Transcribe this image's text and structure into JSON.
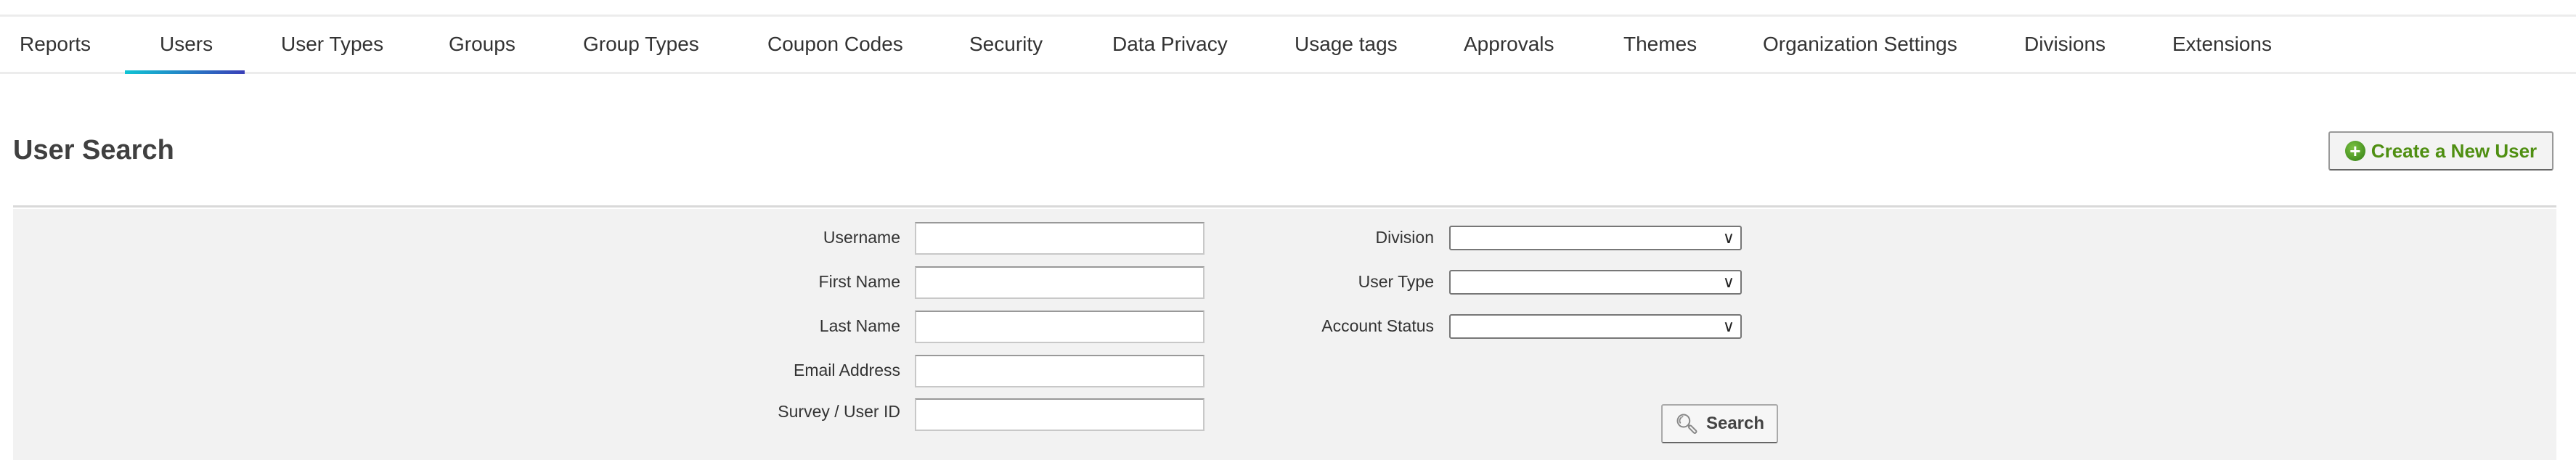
{
  "nav": {
    "tabs": [
      "Reports",
      "Users",
      "User Types",
      "Groups",
      "Group Types",
      "Coupon Codes",
      "Security",
      "Data Privacy",
      "Usage tags",
      "Approvals",
      "Themes",
      "Organization Settings",
      "Divisions",
      "Extensions"
    ],
    "active": "Users"
  },
  "page": {
    "title": "User Search",
    "create_button": "Create a New User"
  },
  "form": {
    "left_fields": [
      {
        "label": "Username",
        "value": ""
      },
      {
        "label": "First Name",
        "value": ""
      },
      {
        "label": "Last Name",
        "value": ""
      },
      {
        "label": "Email Address",
        "value": ""
      },
      {
        "label": "Survey / User ID",
        "value": ""
      }
    ],
    "right_fields": [
      {
        "label": "Division",
        "value": ""
      },
      {
        "label": "User Type",
        "value": ""
      },
      {
        "label": "Account Status",
        "value": ""
      }
    ],
    "search_button": "Search"
  },
  "colors": {
    "accent_start": "#0fc4d4",
    "accent_end": "#3a3fb8",
    "create_green": "#4f8f12"
  },
  "icons": {
    "create": "plus-circle-icon",
    "search": "magnifier-icon",
    "select": "chevron-down-icon"
  }
}
